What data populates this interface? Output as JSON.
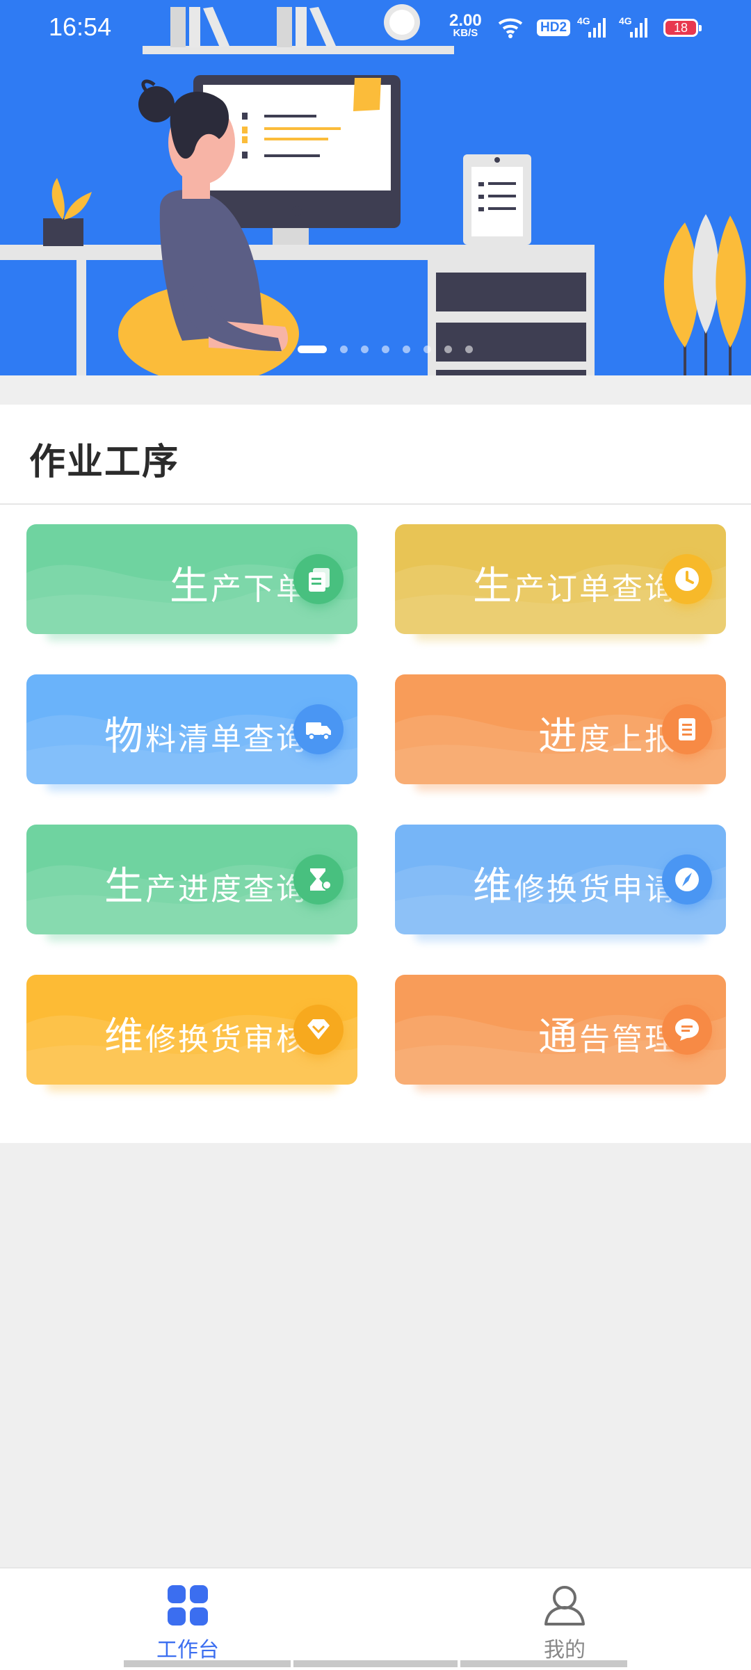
{
  "status_bar": {
    "time": "16:54",
    "speed_value": "2.00",
    "speed_unit": "KB/S",
    "hd_badge": "HD2",
    "signal_1": "4G",
    "signal_2": "4G",
    "battery": "18",
    "icons": [
      "clock-icon",
      "wifi-icon",
      "signal-icon",
      "battery-icon"
    ]
  },
  "banner": {
    "slide_count": 8,
    "active_slide": 1
  },
  "section": {
    "title": "作业工序",
    "cards": [
      {
        "label_first": "生",
        "label_rest": "产下单",
        "icon": "document-icon",
        "color": "#6fd3a0",
        "icon_color": "#48c07f"
      },
      {
        "label_first": "生",
        "label_rest": "产订单查询",
        "icon": "clock-icon",
        "color": "#e8c455",
        "icon_color": "#f7b92a"
      },
      {
        "label_first": "物",
        "label_rest": "料清单查询",
        "icon": "truck-icon",
        "color": "#6ab3fa",
        "icon_color": "#4a96f3"
      },
      {
        "label_first": "进",
        "label_rest": "度上报",
        "icon": "report-icon",
        "color": "#f89c59",
        "icon_color": "#f78a45"
      },
      {
        "label_first": "生",
        "label_rest": "产进度查询",
        "icon": "hourglass-icon",
        "color": "#6fd3a0",
        "icon_color": "#48c07f"
      },
      {
        "label_first": "维",
        "label_rest": "修换货申请",
        "icon": "compass-icon",
        "color": "#76b5f7",
        "icon_color": "#4a96f3"
      },
      {
        "label_first": "维",
        "label_rest": "修换货审核",
        "icon": "diamond-icon",
        "color": "#fdbb35",
        "icon_color": "#f7a91e"
      },
      {
        "label_first": "通",
        "label_rest": "告管理",
        "icon": "message-icon",
        "color": "#f89c59",
        "icon_color": "#f78a45"
      }
    ]
  },
  "tabbar": {
    "tabs": [
      {
        "label": "工作台",
        "icon": "grid-icon",
        "active": true
      },
      {
        "label": "我的",
        "icon": "user-icon",
        "active": false
      }
    ],
    "active_color": "#3b6ef0",
    "inactive_color": "#888888"
  }
}
